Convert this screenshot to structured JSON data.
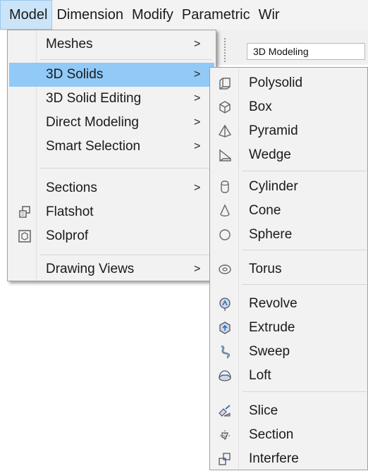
{
  "menubar": {
    "items": [
      "Model",
      "Dimension",
      "Modify",
      "Parametric",
      "Wir"
    ]
  },
  "ribbon": {
    "workspace": "3D Modeling"
  },
  "menu": {
    "items": [
      {
        "label": "Meshes",
        "arrow": ">"
      },
      {
        "label": "3D Solids",
        "arrow": ">"
      },
      {
        "label": "3D Solid Editing",
        "arrow": ">"
      },
      {
        "label": "Direct Modeling",
        "arrow": ">"
      },
      {
        "label": "Smart Selection",
        "arrow": ">"
      },
      {
        "label": "Sections",
        "arrow": ">"
      },
      {
        "label": "Flatshot",
        "icon": "flatshot-icon"
      },
      {
        "label": "Solprof",
        "icon": "solprof-icon"
      },
      {
        "label": "Drawing Views",
        "arrow": ">"
      }
    ]
  },
  "submenu": {
    "items": [
      {
        "label": "Polysolid",
        "icon": "polysolid-icon"
      },
      {
        "label": "Box",
        "icon": "box-icon"
      },
      {
        "label": "Pyramid",
        "icon": "pyramid-icon"
      },
      {
        "label": "Wedge",
        "icon": "wedge-icon"
      },
      {
        "label": "Cylinder",
        "icon": "cylinder-icon"
      },
      {
        "label": "Cone",
        "icon": "cone-icon"
      },
      {
        "label": "Sphere",
        "icon": "sphere-icon"
      },
      {
        "label": "Torus",
        "icon": "torus-icon"
      },
      {
        "label": "Revolve",
        "icon": "revolve-icon"
      },
      {
        "label": "Extrude",
        "icon": "extrude-icon"
      },
      {
        "label": "Sweep",
        "icon": "sweep-icon"
      },
      {
        "label": "Loft",
        "icon": "loft-icon"
      },
      {
        "label": "Slice",
        "icon": "slice-icon"
      },
      {
        "label": "Section",
        "icon": "section-icon"
      },
      {
        "label": "Interfere",
        "icon": "interfere-icon"
      }
    ]
  },
  "colors": {
    "highlight": "#91c9f7",
    "menu_bg": "#f2f2f2",
    "active_menubar": "#cce4f7"
  }
}
